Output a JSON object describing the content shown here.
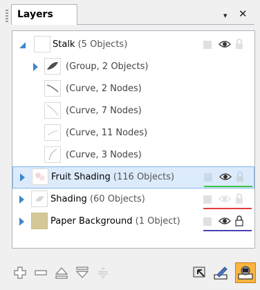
{
  "dock": {
    "tab_title": "Layers",
    "menu_glyph": "▾",
    "close_glyph": "✕"
  },
  "colors": {
    "selection_bg": "#dcebfc",
    "selection_border": "#7eb4ea",
    "expander": "#3d87cb",
    "fruit_shading_color": "#3cc63c",
    "shading_color": "#e23b3b",
    "paper_background_color": "#4a3fb8",
    "active_button": "#f9b543"
  },
  "layers": [
    {
      "name": "Stalk",
      "count": "(5 Objects)",
      "expanded": true,
      "children": [
        {
          "label": "(Group, 2 Objects)",
          "icon": "group-leaf-icon"
        },
        {
          "label": "(Curve, 2 Nodes)",
          "icon": "curve-thumb-icon"
        },
        {
          "label": "(Curve, 7 Nodes)",
          "icon": "curve-thumb-icon"
        },
        {
          "label": "(Curve, 11 Nodes)",
          "icon": "curve-thumb-icon"
        },
        {
          "label": "(Curve, 3 Nodes)",
          "icon": "curve-thumb-icon"
        }
      ]
    },
    {
      "name": "Fruit Shading",
      "count": "(116 Objects)",
      "selected": true
    },
    {
      "name": "Shading",
      "count": "(60 Objects)"
    },
    {
      "name": "Paper Background",
      "count": "(1 Object)",
      "locked": true
    }
  ],
  "toolbar": {
    "buttons": [
      "add-layer-icon",
      "remove-layer-icon",
      "raise-layer-icon",
      "lower-layer-icon",
      "move-layer-icon",
      "select-layer-icon",
      "edit-layer-icon",
      "layer-properties-icon"
    ]
  }
}
